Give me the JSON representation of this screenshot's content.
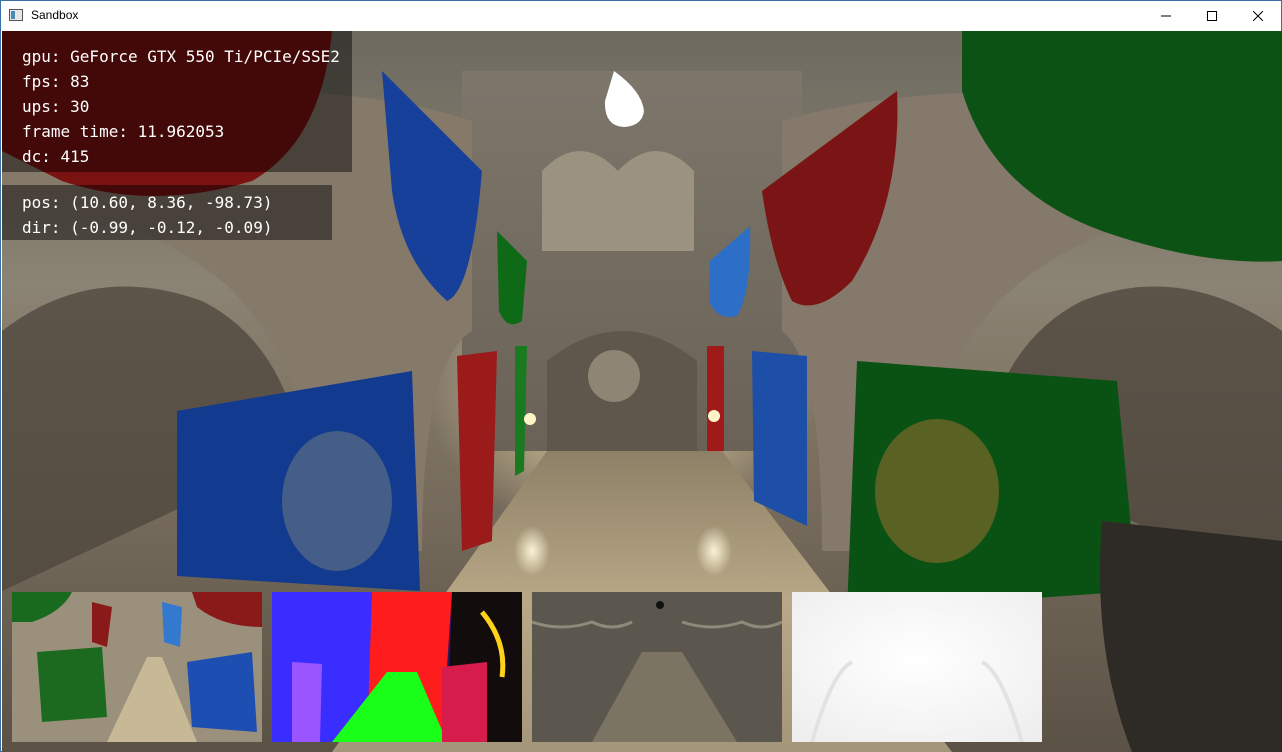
{
  "window": {
    "title": "Sandbox",
    "icon": "app-window-icon",
    "controls": [
      "minimize-icon",
      "maximize-icon",
      "close-icon"
    ]
  },
  "overlay": {
    "stats": {
      "gpu": "gpu: GeForce GTX 550 Ti/PCIe/SSE2",
      "fps": "fps: 83",
      "ups": "ups: 30",
      "frame_time": "frame time: 11.962053",
      "dc": "dc: 415"
    },
    "camera": {
      "pos": "pos: (10.60, 8.36, -98.73)",
      "dir": "dir: (-0.99, -0.12, -0.09)"
    }
  },
  "gbuffer_previews": [
    "albedo",
    "normals",
    "material",
    "depth"
  ],
  "colors": {
    "banner_red": "#8a1313",
    "banner_blue": "#123e96",
    "banner_green": "#0d5d14",
    "stone": "#9a8e78"
  }
}
